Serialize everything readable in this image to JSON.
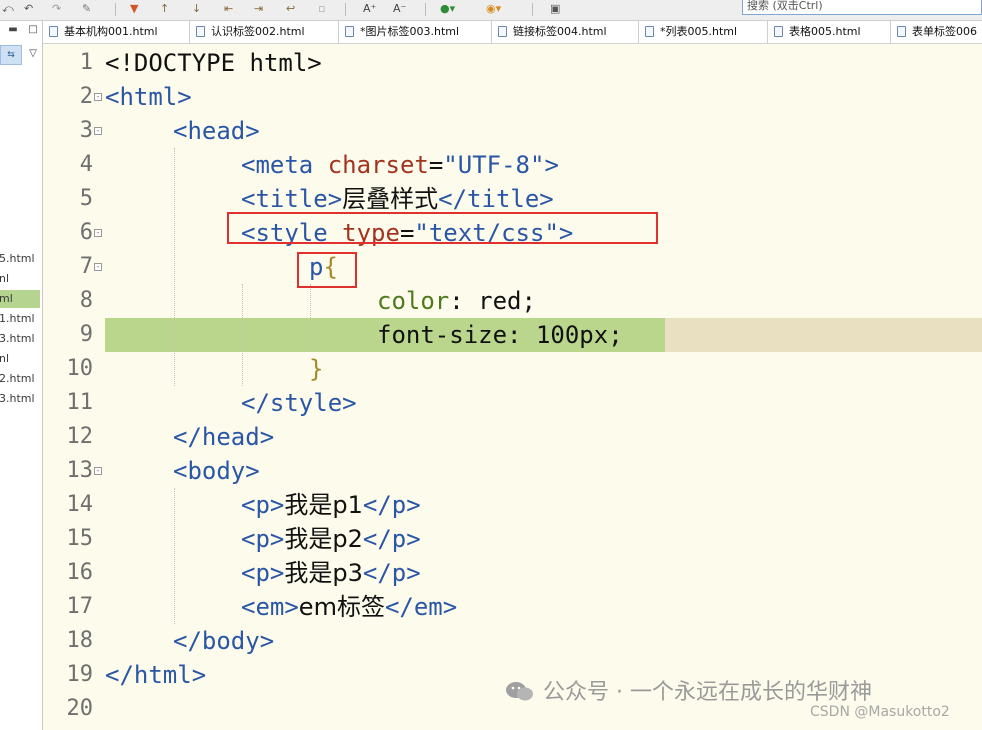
{
  "toolbar": {
    "search_label": "搜索 (双击Ctrl)"
  },
  "sidebar": {
    "items": [
      {
        "label": "5.html",
        "active": false
      },
      {
        "label": "nl",
        "active": false
      },
      {
        "label": "ml",
        "active": true
      },
      {
        "label": "1.html",
        "active": false
      },
      {
        "label": "3.html",
        "active": false
      },
      {
        "label": "nl",
        "active": false
      },
      {
        "label": "2.html",
        "active": false
      },
      {
        "label": "3.html",
        "active": false
      }
    ]
  },
  "tabs": [
    {
      "label": "基本机构001.html"
    },
    {
      "label": "认识标签002.html"
    },
    {
      "label": "*图片标签003.html"
    },
    {
      "label": "链接标签004.html"
    },
    {
      "label": "*列表005.html"
    },
    {
      "label": "表格005.html"
    },
    {
      "label": "表单标签006"
    }
  ],
  "editor": {
    "line_numbers": [
      "1",
      "2",
      "3",
      "4",
      "5",
      "6",
      "7",
      "8",
      "9",
      "10",
      "11",
      "12",
      "13",
      "14",
      "15",
      "16",
      "17",
      "18",
      "19",
      "20"
    ],
    "highlighted_line": 9,
    "code": {
      "l1_doctype": "<!DOCTYPE html>",
      "l2_open": "<html>",
      "l3_open": "<head>",
      "l4_lt": "<",
      "l4_tag": "meta",
      "l4_attr": " charset",
      "l4_eq": "=",
      "l4_val": "\"UTF-8\"",
      "l4_gt": ">",
      "l5_open": "<title>",
      "l5_text": "层叠样式",
      "l5_close": "</title>",
      "l6_lt": "<",
      "l6_tag": "style",
      "l6_attr": " type",
      "l6_eq": "=",
      "l6_val": "\"text/css\"",
      "l6_gt": ">",
      "l7_sel": "p",
      "l7_brace": "{",
      "l8_prop": "color",
      "l8_rest": ": red;",
      "l9_prop": "font-size",
      "l9_rest": ": 100px;",
      "l10_brace": "}",
      "l11_close": "</style>",
      "l12_close": "</head>",
      "l13_open": "<body>",
      "l14_open": "<p>",
      "l14_text": "我是p1",
      "l14_close": "</p>",
      "l15_open": "<p>",
      "l15_text": "我是p2",
      "l15_close": "</p>",
      "l16_open": "<p>",
      "l16_text": "我是p3",
      "l16_close": "</p>",
      "l17_open": "<em>",
      "l17_text": "em标签",
      "l17_close": "</em>",
      "l18_close": "</body>",
      "l19_close": "</html>"
    }
  },
  "watermark": {
    "text": "公众号 · 一个永远在成长的华财神",
    "csdn": "CSDN @Masukotto2"
  },
  "colors": {
    "tag": "#2a56a6",
    "attr": "#a3331f",
    "property": "#4e7a1b",
    "highlight": "#b9d68c",
    "annotation": "#e0312f",
    "editor_bg": "#fdfbec"
  }
}
